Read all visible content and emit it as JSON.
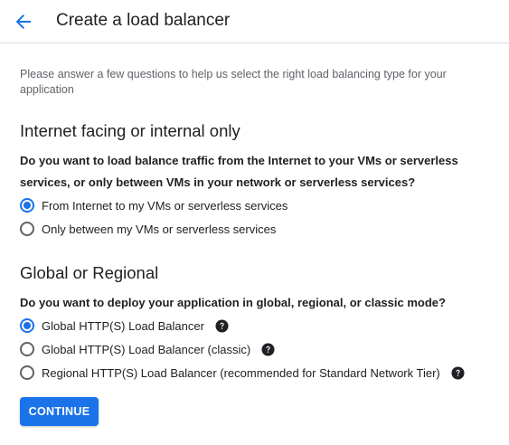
{
  "header": {
    "title": "Create a load balancer",
    "back_icon": "arrow-back-icon"
  },
  "intro_text": "Please answer a few questions to help us select the right load balancing type for your application",
  "sections": [
    {
      "title": "Internet facing or internal only",
      "question": "Do you want to load balance traffic from the Internet to your VMs or serverless services, or only between VMs in your network or serverless services?",
      "options": [
        {
          "label": "From Internet to my VMs or serverless services",
          "selected": true
        },
        {
          "label": "Only between my VMs or serverless services",
          "selected": false
        }
      ]
    },
    {
      "title": "Global or Regional",
      "question": "Do you want to deploy your application in global, regional, or classic mode?",
      "options": [
        {
          "label": "Global HTTP(S) Load Balancer",
          "selected": true,
          "help_icon": "help-icon"
        },
        {
          "label": "Global HTTP(S) Load Balancer (classic)",
          "selected": false,
          "help_icon": "help-icon"
        },
        {
          "label": "Regional HTTP(S) Load Balancer (recommended for Standard Network Tier)",
          "selected": false,
          "help_icon": "help-icon"
        }
      ]
    }
  ],
  "continue_label": "CONTINUE",
  "colors": {
    "accent": "#1a73e8",
    "text_primary": "#202124",
    "text_secondary": "#5f6368",
    "divider": "#dadce0"
  }
}
